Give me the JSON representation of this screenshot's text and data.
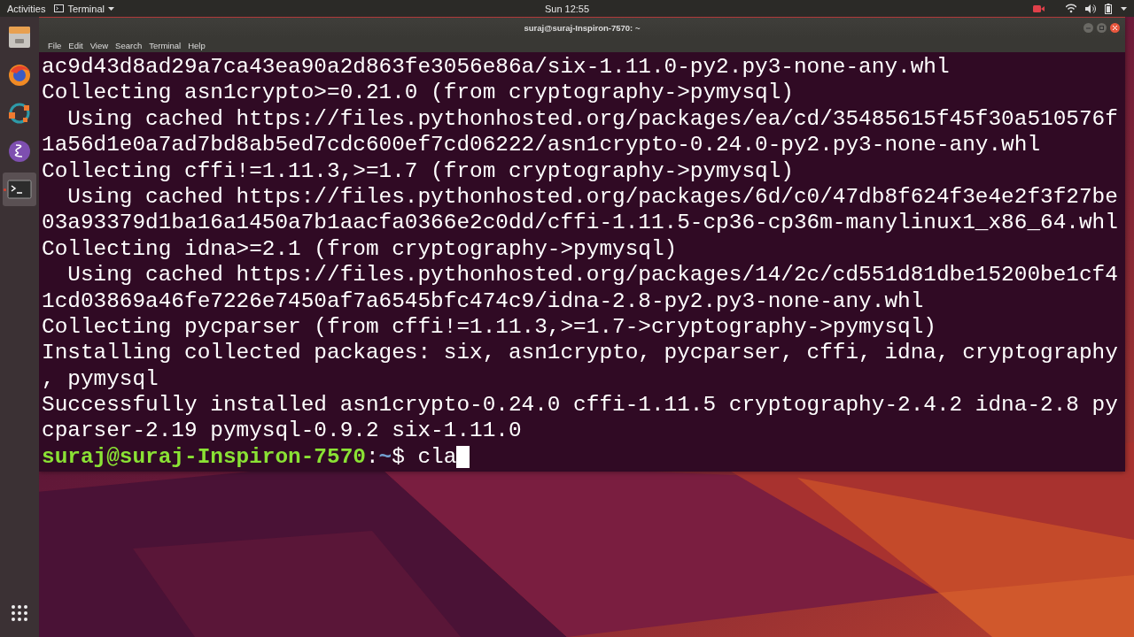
{
  "top_bar": {
    "activities": "Activities",
    "app_menu": "Terminal",
    "clock": "Sun 12:55",
    "recording": true
  },
  "dock": {
    "items": [
      {
        "kind": "files",
        "running": false
      },
      {
        "kind": "browser",
        "running": false
      },
      {
        "kind": "orbit",
        "running": false
      },
      {
        "kind": "emacs",
        "running": false
      },
      {
        "kind": "terminal",
        "running": true
      }
    ]
  },
  "window": {
    "title": "suraj@suraj-Inspiron-7570: ~",
    "menu": [
      "File",
      "Edit",
      "View",
      "Search",
      "Terminal",
      "Help"
    ],
    "lines": [
      {
        "kind": "output",
        "text": "ac9d43d8ad29a7ca43ea90a2d863fe3056e86a/six-1.11.0-py2.py3-none-any.whl"
      },
      {
        "kind": "output",
        "text": "Collecting asn1crypto>=0.21.0 (from cryptography->pymysql)"
      },
      {
        "kind": "output",
        "text": "  Using cached https://files.pythonhosted.org/packages/ea/cd/35485615f45f30a510576f"
      },
      {
        "kind": "output",
        "text": "1a56d1e0a7ad7bd8ab5ed7cdc600ef7cd06222/asn1crypto-0.24.0-py2.py3-none-any.whl"
      },
      {
        "kind": "output",
        "text": "Collecting cffi!=1.11.3,>=1.7 (from cryptography->pymysql)"
      },
      {
        "kind": "output",
        "text": "  Using cached https://files.pythonhosted.org/packages/6d/c0/47db8f624f3e4e2f3f27be"
      },
      {
        "kind": "output",
        "text": "03a93379d1ba16a1450a7b1aacfa0366e2c0dd/cffi-1.11.5-cp36-cp36m-manylinux1_x86_64.whl"
      },
      {
        "kind": "output",
        "text": "Collecting idna>=2.1 (from cryptography->pymysql)"
      },
      {
        "kind": "output",
        "text": "  Using cached https://files.pythonhosted.org/packages/14/2c/cd551d81dbe15200be1cf4"
      },
      {
        "kind": "output",
        "text": "1cd03869a46fe7226e7450af7a6545bfc474c9/idna-2.8-py2.py3-none-any.whl"
      },
      {
        "kind": "output",
        "text": "Collecting pycparser (from cffi!=1.11.3,>=1.7->cryptography->pymysql)"
      },
      {
        "kind": "output",
        "text": "Installing collected packages: six, asn1crypto, pycparser, cffi, idna, cryptography"
      },
      {
        "kind": "output",
        "text": ", pymysql"
      },
      {
        "kind": "output",
        "text": "Successfully installed asn1crypto-0.24.0 cffi-1.11.5 cryptography-2.4.2 idna-2.8 py"
      },
      {
        "kind": "output",
        "text": "cparser-2.19 pymysql-0.9.2 six-1.11.0"
      },
      {
        "kind": "prompt",
        "user_host": "suraj@suraj-Inspiron-7570",
        "separator": ":",
        "path": "~",
        "symbol": "$",
        "command": "cla"
      }
    ]
  }
}
